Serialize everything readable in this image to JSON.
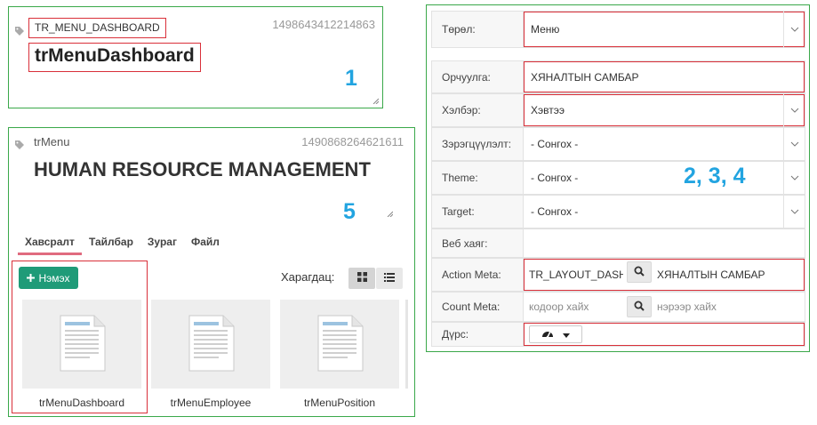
{
  "panel1": {
    "code": "TR_MENU_DASHBOARD",
    "record_id": "1498643412214863",
    "title": "trMenuDashboard",
    "annotation": "1"
  },
  "panel2": {
    "code": "trMenu",
    "record_id": "1490868264621611",
    "title": "HUMAN RESOURCE MANAGEMENT",
    "annotation": "5",
    "tabs": [
      {
        "label": "Хавсралт",
        "active": true
      },
      {
        "label": "Тайлбар",
        "active": false
      },
      {
        "label": "Зураг",
        "active": false
      },
      {
        "label": "Файл",
        "active": false
      }
    ],
    "add_button": "Нэмэх",
    "view_label": "Харагдац:",
    "files": [
      {
        "name": "trMenuDashboard",
        "icon": "document-icon"
      },
      {
        "name": "trMenuEmployee",
        "icon": "document-icon"
      },
      {
        "name": "trMenuPosition",
        "icon": "document-icon"
      }
    ],
    "colors": {
      "add_button": "#1f9b78",
      "active_tab": "#e06b7f"
    }
  },
  "form": {
    "annotation": "2, 3, 4",
    "rows": [
      {
        "label": "Төрөл:",
        "value": "Меню",
        "type": "select"
      },
      {
        "label": "Орчуулга:",
        "value": "ХЯНАЛТЫН САМБАР",
        "type": "text"
      },
      {
        "label": "Хэлбэр:",
        "value": "Хэвтээ",
        "type": "select"
      },
      {
        "label": "Зэрэгцүүлэлт:",
        "value": "- Сонгох -",
        "type": "select"
      },
      {
        "label": "Theme:",
        "value": "- Сонгох -",
        "type": "select"
      },
      {
        "label": "Target:",
        "value": "- Сонгох -",
        "type": "select"
      },
      {
        "label": "Веб хаяг:",
        "value": "",
        "type": "text"
      },
      {
        "label": "Action Meta:",
        "code": "TR_LAYOUT_DASHBOARD",
        "name": "ХЯНАЛТЫН САМБАР",
        "type": "lookup"
      },
      {
        "label": "Count Meta:",
        "code_placeholder": "кодоор хайх",
        "name_placeholder": "нэрээр хайх",
        "type": "lookup"
      },
      {
        "label": "Дүрс:",
        "icon": "dashboard-icon",
        "type": "icon"
      }
    ]
  },
  "colors": {
    "highlight": "#d9303a",
    "panel_border": "#3aa84a",
    "annotation": "#22a4e0"
  }
}
